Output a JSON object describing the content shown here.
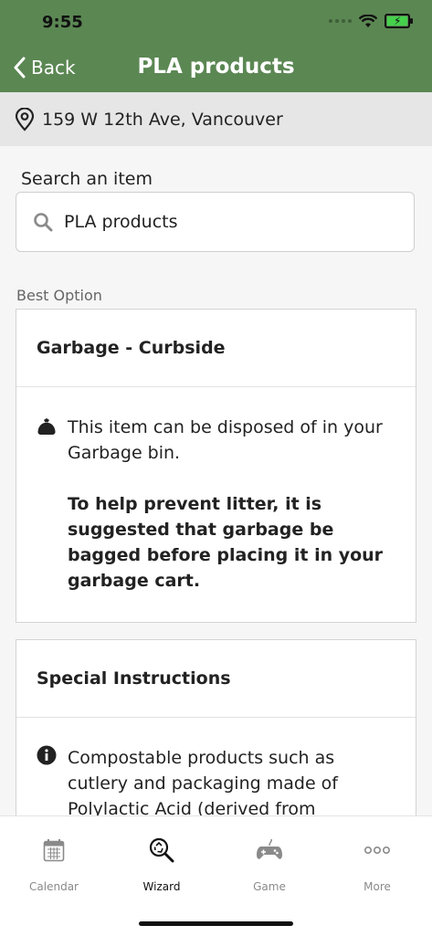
{
  "status_bar": {
    "time": "9:55"
  },
  "header": {
    "back_label": "Back",
    "title": "PLA products"
  },
  "location": {
    "address": "159 W 12th Ave, Vancouver"
  },
  "search": {
    "label": "Search an item",
    "value": "PLA products"
  },
  "best_option": {
    "label": "Best Option",
    "title": "Garbage  -  Curbside",
    "text": "This item can be disposed of in your Garbage bin.",
    "note": "To help prevent litter, it is suggested that garbage be bagged before placing it in your garbage cart."
  },
  "special_instructions": {
    "title": "Special Instructions",
    "text": "Compostable products such as cutlery and packaging made of Polylactic Acid (derived from"
  },
  "tabbar": {
    "tabs": [
      {
        "label": "Calendar",
        "icon": "calendar-icon",
        "active": false
      },
      {
        "label": "Wizard",
        "icon": "wizard-icon",
        "active": true
      },
      {
        "label": "Game",
        "icon": "game-controller-icon",
        "active": false
      },
      {
        "label": "More",
        "icon": "more-icon",
        "active": false
      }
    ]
  },
  "colors": {
    "header": "#5b8753",
    "location_bar": "#e6e6e6",
    "background": "#f6f6f6"
  }
}
